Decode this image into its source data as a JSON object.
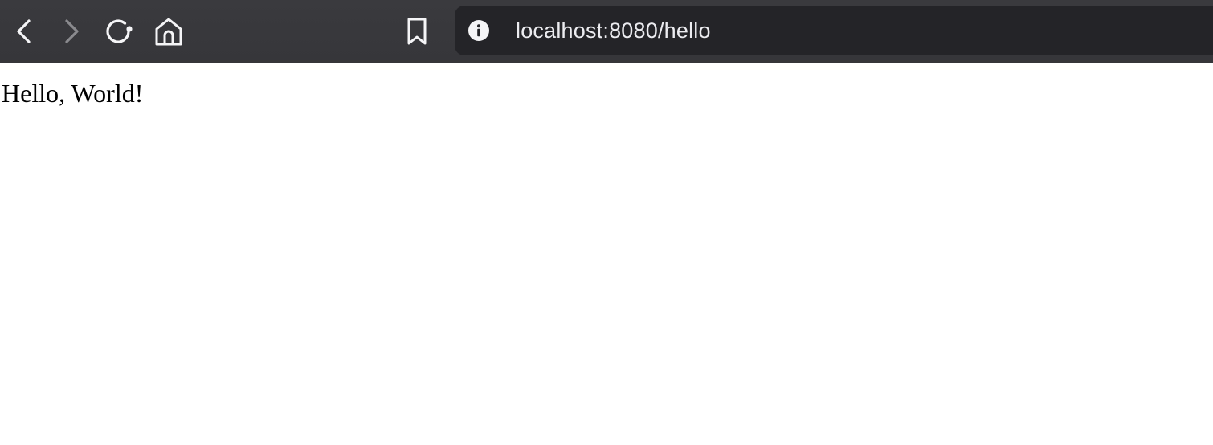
{
  "toolbar": {
    "back_icon": "chevron-left-icon",
    "forward_icon": "chevron-right-icon",
    "reload_icon": "reload-icon",
    "home_icon": "home-icon",
    "bookmark_icon": "bookmark-icon"
  },
  "url_bar": {
    "info_icon": "info-icon",
    "host": "localhost:8080",
    "path": "/hello"
  },
  "page": {
    "body_text": "Hello, World!"
  },
  "colors": {
    "toolbar_bg": "#38383c",
    "url_bar_bg": "#242428",
    "icon_active": "#f5f5f7",
    "icon_disabled": "#8a8a8e",
    "page_bg": "#ffffff"
  }
}
